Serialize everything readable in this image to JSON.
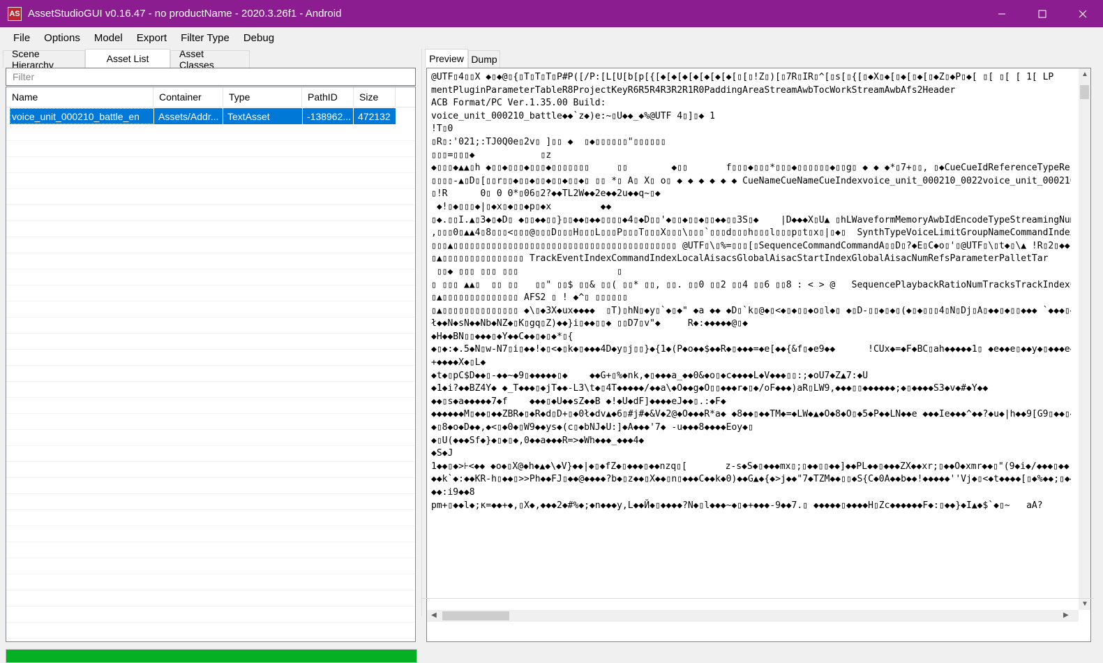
{
  "window": {
    "title": "AssetStudioGUI v0.16.47 - no productName - 2020.3.26f1 - Android",
    "icon": "AS"
  },
  "menu": [
    "File",
    "Options",
    "Model",
    "Export",
    "Filter Type",
    "Debug"
  ],
  "left_tabs": [
    "Scene Hierarchy",
    "Asset List",
    "Asset Classes"
  ],
  "filter_placeholder": "Filter",
  "columns": [
    "Name",
    "Container",
    "Type",
    "PathID",
    "Size"
  ],
  "rows": [
    {
      "name": "voice_unit_000210_battle_en",
      "container": "Assets/Addr...",
      "type": "TextAsset",
      "pathid": "-138962...",
      "size": "472132"
    }
  ],
  "progress": 1.0,
  "right_tabs": [
    "Preview",
    "Dump"
  ],
  "preview_lines": [
    "@UTF▯4▯▯X ◆▯◆@▯{▯T▯T▯T▯P#P([/P:[L[U[b[p[{[◆[◆[◆[◆[◆[◆[◆[▯[▯!Z▯)[▯7R▯IR▯^[▯s[▯{[▯◆X▯◆[▯◆[▯◆[▯◆Z▯◆P▯◆[ ▯[ ▯[ [ 1[ LP",
    "mentPluginParameterTableR8ProjectKeyR6R5R4R3R2R1R0PaddingAreaStreamAwbTocWorkStreamAwbAfs2Header",
    "ACB Format/PC Ver.1.35.00 Build:",
    "voice_unit_000210_battle◆◆`z◆)e:~▯U◆◆_◆%@UTF 4▯]▯◆ 1",
    "",
    "!T▯0",
    "▯R▯:'021;:TJ0Q0e▯2v▯ ]▯▯ ◆  ▯◆▯▯▯▯▯▯\"▯▯▯▯▯▯",
    "▯▯▯=▯▯▯◆            ▯z",
    "",
    "",
    "◆▯▯▯◆▲▲▯h ◆▯▯◆▯▯▯◆▯▯▯◆▯▯▯▯▯▯▯     ▯▯        ◆▯▯       f▯▯▯◆▯▯▯*▯▯▯◆▯▯▯▯▯▯◆▯▯g▯ ◆ ◆ ◆*▯7+▯▯, ▯◆CueCueIdReferenceTypeReferenceIndexU",
    "▯▯▯▯-▲▯D▯[▯▯r▯▯◆▯▯◆▯▯◆▯▯◆▯▯◆▯ ▯▯ *▯ A▯ X▯ o▯ ◆ ◆ ◆ ◆ ◆ ◆ CueNameCueNameCueIndexvoice_unit_000210_0022voice_unit_000210",
    "▯!R      0▯ 0 0*▯06▯2?◆◆TL2W◆◆2e◆◆2u◆◆q~▯◆",
    " ◆!▯◆▯▯▯◆|▯◆x▯◆▯▯◆p▯◆x         ◆◆",
    "▯◆.▯▯I.▲▯3◆▯◆D▯ ◆▯▯◆◆▯▯}▯▯◆◆▯◆◆▯▯▯▯◆4▯◆D▯▯'◆▯▯◆▯▯◆▯▯◆◆▯▯3S▯◆    |D◆◆◆X▯U▲ ▯hLWaveformMemoryAwbIdEncodeTypeStreamingNumChann",
    "",
    ",▯▯▯0▯▲▲4▯8▯▯▯<▯▯▯@▯▯▯D▯▯▯H▯▯▯L▯▯▯P▯▯▯T▯▯▯X▯▯▯\\▯▯▯`▯▯▯d▯▯▯h▯▯▯l▯▯▯p▯t▯x▯|▯◆▯  SynthTypeVoiceLimitGroupNameCommandIndexReferenceI",
    "▯▯▯▲▯▯▯▯▯▯▯▯▯▯▯▯▯▯▯▯▯▯▯▯▯▯▯▯▯▯▯▯▯▯▯▯▯▯▯▯▯▯▯▯▯ @UTF▯\\▯%=▯▯▯[▯SequenceCommandCommandA▯▯D▯?◆E▯C◆o▯'▯@UTF▯\\▯t◆▯\\▲ !R▯2▯◆◆;2*◆◆2@2S◆◆0c:ny4z◆◆◆",
    "▯▲▯▯▯▯▯▯▯▯▯▯▯▯▯▯▯ TrackEventIndexCommandIndexLocalAisacsGlobalAisacStartIndexGlobalAisacNumRefsParameterPalletTar",
    " ▯▯◆ ▯▯▯ ▯▯▯ ▯▯▯                  ▯",
    "",
    "▯ ▯▯▯ ▲▲▯  ▯▯ ▯▯   ▯▯\" ▯▯$ ▯▯& ▯▯( ▯▯* ▯▯, ▯▯. ▯▯0 ▯▯2 ▯▯4 ▯▯6 ▯▯8 : < > @   SequencePlaybackRatioNumTracksTrackIndexCommandInd",
    "▯▲▯▯▯▯▯▯▯▯▯▯▯▯▯▯ AFS2 ▯ ! ◆^▯ ▯▯▯▯▯▯",
    "▯▲▯▯▯▯▯▯▯▯▯▯▯▯▯▯ ◆\\▯◆3X◆ux◆◆◆◆  ▯T)▯hN▯◆y▯`◆▯◆\" ◆a ◆◆ ◆D▯`k▯@◆▯<◆▯◆▯▯◆o▯l◆▯ ◆▯D-▯▯◆▯◆▯(◆▯◆▯▯▯4▯N▯Dj▯A▯◆◆▯◆▯▯◆◆◆ `◆◆◆▯◆◆◆  ◆◆◆◆◆▯▯▯◆M▯◆◆",
    "ł◆◆N◆sN◆◆Nb◆NZ◆▯K▯gq▯Z)◆◆}i▯◆◆▯▯◆ ▯▯D7▯v\"◆     R◆:◆◆◆◆◆@▯◆",
    "◆H◆◆BN▯▯◆◆◆▯◆Y◆◆C◆◆▯◆▯◆*▯{",
    "◆▯◆:◆.5◆N▯w-N7▯i▯◆◆!◆▯<◆▯k◆▯◆◆◆4D◆y▯j▯▯}◆{1◆(P◆o◆◆$◆◆R◆▯◆◆◆=◆e[◆◆{&f▯◆e9◆◆      !CUx◆=◆F◆BC▯ah◆◆◆◆◆1▯ ◆e◆◆e▯◆◆y◆▯◆◆◆e◆",
    "+◆◆◆◆X◆▯L◆",
    "◆t◆▯pC$D◆◆▯-◆◆~◆9▯◆◆◆◆◆▯◆    ◆◆G+▯%◆nk,◆▯◆◆◆a_◆◆0&◆o▯◆c◆◆◆◆L◆V◆◆◆▯▯:;◆oU7◆Z▲7:◆U",
    "◆1◆i?◆◆BZ4Y◆ ◆_T◆◆◆▯◆jT◆◆-L3\\t◆▯4T◆◆◆◆◆/◆◆a\\◆O◆◆g◆O▯▯◆◆◆r◆▯◆/oF◆◆◆)aR▯LW9,◆◆◆▯▯◆◆◆◆◆◆;◆▯◆◆◆◆S3◆v◆#◆Y◆◆",
    "◆◆▯s◆a◆◆◆◆◆7◆f    ◆◆◆▯◆U◆◆sZ◆◆B ◆!◆U◆dF]◆◆◆◆eJ◆◆▯.:◆F◆",
    "◆◆◆◆◆◆M▯◆◆▯◆◆ZBR◆▯◆R◆d▯D+▯◆0ł◆dv▲◆6▯#j#◆&V◆2@◆O◆◆◆R*a◆ ◆8◆◆▯◆◆TM◆=◆LW◆▲◆O◆8◆O▯◆5◆P◆◆LN◆◆e ◆◆◆Ie◆◆◆^◆◆?◆u◆|h◆◆9[G9▯◆◆▯◆",
    "◆▯8◆o◆D◆◆,◆<▯◆0◆▯W9◆◆ys◆(c▯◆bNJ◆U:]◆A◆◆◆'7◆ -u◆◆◆8◆◆◆◆Eoy◆▯",
    "◆▯U(◆◆◆Sf◆}◆▯◆▯◆,0◆◆a◆◆◆R=>◆Wh◆◆◆_◆◆◆4◆",
    "◆S◆J",
    "1◆◆▯◆>⊦<◆◆ ◆o◆▯X@◆h◆▲◆\\◆V}◆◆|◆▯◆fZ◆▯◆◆◆▯◆◆nzq▯[       z-s◆S◆▯◆◆◆mx▯;▯◆◆▯▯◆◆]◆◆PL◆◆▯◆◆◆ZX◆◆xr;▯◆◆O◆xmr◆◆▯\"(9◆i◆/◆◆◆▯◆◆|◆◆◆",
    "◆◆k`◆:◆◆KR-h▯◆◆▯>>Ph◆◆FJ▯◆◆@◆◆◆◆?b◆▯z◆◆▯X◆◆▯n▯◆◆◆C◆◆k◆0)◆◆G▲◆{◆>j◆◆\"7◆TZM◆◆▯▯◆S{C◆0A◆◆b◆◆!◆◆◆◆◆''Vj◆▯<◆t◆◆◆◆[▯◆%◆◆;▯◆◆",
    "◆◆:i9◆◆8",
    "pm+▯◆◆l◆;κ=◆◆+◆,▯X◆,◆◆◆2◆#%◆;◆n◆◆◆y,L◆◆Й◆▯◆◆◆◆?N◆▯l◆◆◆~◆▯◆+◆◆◆-9◆◆7.▯ ◆◆◆◆◆▯◆◆◆◆H▯Zc◆◆◆◆◆◆F◆:▯◆◆}◆I▲◆$`◆▯~   aA?"
  ]
}
